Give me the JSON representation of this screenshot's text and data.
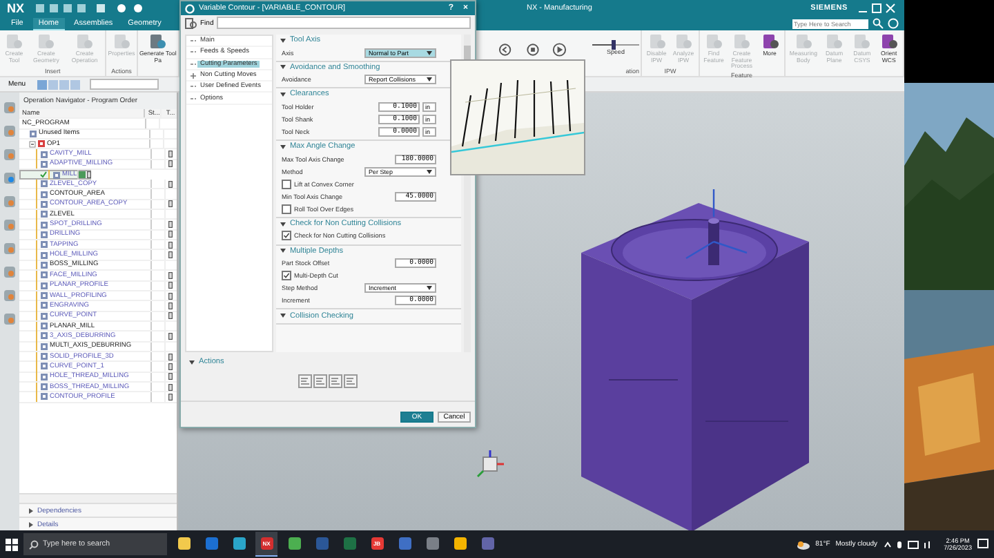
{
  "app": {
    "logo": "NX",
    "title": "NX - Manufacturing",
    "brand": "SIEMENS"
  },
  "tabs": [
    {
      "label": "File",
      "selected": false
    },
    {
      "label": "Home",
      "selected": true
    },
    {
      "label": "Assemblies",
      "selected": false
    },
    {
      "label": "Geometry",
      "selected": false
    }
  ],
  "search": {
    "placeholder": "Type Here to Search"
  },
  "ribbon_left": [
    {
      "group": "Insert",
      "buttons": [
        {
          "label": "Create Tool",
          "disabled": true
        },
        {
          "label": "Create Geometry",
          "disabled": true
        },
        {
          "label": "Create Operation",
          "disabled": true
        }
      ]
    },
    {
      "group": "Actions",
      "buttons": [
        {
          "label": "Properties",
          "disabled": true
        }
      ]
    },
    {
      "buttons": [
        {
          "label": "Generate Tool Pa",
          "disabled": false
        }
      ]
    }
  ],
  "ribbon_right": [
    {
      "kind": "simulation",
      "group": "ation",
      "speed": {
        "label": "Speed",
        "level": 0.45
      }
    },
    {
      "kind": "buttons",
      "group": "IPW",
      "buttons": [
        {
          "label": "Disable IPW",
          "disabled": true
        },
        {
          "label": "Analyze IPW",
          "disabled": true
        }
      ]
    },
    {
      "kind": "buttons",
      "group": "Feature",
      "buttons": [
        {
          "label": "Find Feature",
          "disabled": true
        },
        {
          "label": "Create Feature Process",
          "disabled": true
        },
        {
          "label": "More",
          "disabled": false
        }
      ]
    },
    {
      "kind": "buttons",
      "buttons": [
        {
          "label": "Measuring Body",
          "disabled": true
        },
        {
          "label": "Datum Plane",
          "disabled": true
        },
        {
          "label": "Datum CSYS",
          "disabled": true
        },
        {
          "label": "Orient WCS",
          "disabled": false
        }
      ]
    }
  ],
  "toolbar": {
    "menu": "Menu"
  },
  "navigator": {
    "title": "Operation Navigator - Program Order",
    "columns": [
      "Name",
      "St...",
      "T..."
    ],
    "tree": {
      "label": "NC_PROGRAM",
      "children": [
        {
          "label": "Unused Items"
        },
        {
          "label": "OP1",
          "children": [
            {
              "label": "CAVITY_MILL",
              "generated": true,
              "complete": false
            },
            {
              "label": "ADAPTIVE_MILLING",
              "generated": true,
              "complete": false
            },
            {
              "label": "MILL",
              "generated": true,
              "complete": true
            },
            {
              "label": "ZLEVEL_COPY",
              "generated": true,
              "complete": false
            },
            {
              "label": "CONTOUR_AREA",
              "generated": false,
              "complete": false
            },
            {
              "label": "CONTOUR_AREA_COPY",
              "generated": true,
              "complete": false
            },
            {
              "label": "ZLEVEL",
              "generated": false,
              "complete": false
            },
            {
              "label": "SPOT_DRILLING",
              "generated": true,
              "complete": false
            },
            {
              "label": "DRILLING",
              "generated": true,
              "complete": false
            },
            {
              "label": "TAPPING",
              "generated": true,
              "complete": false
            },
            {
              "label": "HOLE_MILLING",
              "generated": true,
              "complete": false
            },
            {
              "label": "BOSS_MILLING",
              "generated": false,
              "complete": false
            },
            {
              "label": "FACE_MILLING",
              "generated": true,
              "complete": false
            },
            {
              "label": "PLANAR_PROFILE",
              "generated": true,
              "complete": false
            },
            {
              "label": "WALL_PROFILING",
              "generated": true,
              "complete": false
            },
            {
              "label": "ENGRAVING",
              "generated": true,
              "complete": false
            },
            {
              "label": "CURVE_POINT",
              "generated": true,
              "complete": false
            },
            {
              "label": "PLANAR_MILL",
              "generated": false,
              "complete": false
            },
            {
              "label": "3_AXIS_DEBURRING",
              "generated": true,
              "complete": false
            },
            {
              "label": "MULTI_AXIS_DEBURRING",
              "generated": false,
              "complete": false
            },
            {
              "label": "SOLID_PROFILE_3D",
              "generated": true,
              "complete": false
            },
            {
              "label": "CURVE_POINT_1",
              "generated": true,
              "complete": false
            },
            {
              "label": "HOLE_THREAD_MILLING",
              "generated": true,
              "complete": false
            },
            {
              "label": "BOSS_THREAD_MILLING",
              "generated": true,
              "complete": false
            },
            {
              "label": "CONTOUR_PROFILE",
              "generated": true,
              "complete": false
            }
          ]
        }
      ]
    },
    "panels": [
      {
        "label": "Dependencies",
        "expanded": false
      },
      {
        "label": "Details",
        "expanded": false
      }
    ]
  },
  "dialog": {
    "title": "Variable Contour - [VARIABLE_CONTOUR]",
    "help": "?",
    "close": "×",
    "find_label": "Find",
    "tree": [
      {
        "label": "Main",
        "selected": false,
        "expandable": false
      },
      {
        "label": "Feeds & Speeds",
        "selected": false,
        "expandable": false
      },
      {
        "label": "Cutting Parameters",
        "selected": true,
        "expandable": false
      },
      {
        "label": "Non Cutting Moves",
        "selected": false,
        "expandable": true
      },
      {
        "label": "User Defined Events",
        "selected": false,
        "expandable": false
      },
      {
        "label": "Options",
        "selected": false,
        "expandable": false
      }
    ],
    "sections": [
      {
        "title": "Tool Axis",
        "rows": [
          {
            "kind": "select",
            "label": "Axis",
            "value": "Normal to Part",
            "highlighted": true
          }
        ]
      },
      {
        "title": "Avoidance and Smoothing",
        "rows": [
          {
            "kind": "select",
            "label": "Avoidance",
            "value": "Report Collisions",
            "highlighted": false
          }
        ]
      },
      {
        "title": "Clearances",
        "rows": [
          {
            "kind": "number",
            "label": "Tool Holder",
            "value": "0.1000",
            "unit": "in"
          },
          {
            "kind": "number",
            "label": "Tool Shank",
            "value": "0.1000",
            "unit": "in"
          },
          {
            "kind": "number",
            "label": "Tool Neck",
            "value": "0.0000",
            "unit": "in"
          }
        ]
      },
      {
        "title": "Max Angle Change",
        "rows": [
          {
            "kind": "number",
            "label": "Max Tool Axis Change",
            "value": "180.0000"
          },
          {
            "kind": "select",
            "label": "Method",
            "value": "Per Step",
            "highlighted": false
          },
          {
            "kind": "check",
            "label": "Lift at Convex Corner",
            "checked": false
          },
          {
            "kind": "number",
            "label": "Min Tool Axis Change",
            "value": "45.0000"
          },
          {
            "kind": "check",
            "label": "Roll Tool Over Edges",
            "checked": false
          }
        ]
      },
      {
        "title": "Check for Non Cutting Collisions",
        "rows": [
          {
            "kind": "check",
            "label": "Check for Non Cutting Collisions",
            "checked": true
          }
        ]
      },
      {
        "title": "Multiple Depths",
        "rows": [
          {
            "kind": "number",
            "label": "Part Stock Offset",
            "value": "0.0000"
          },
          {
            "kind": "check",
            "label": "Multi-Depth Cut",
            "checked": true
          },
          {
            "kind": "select",
            "label": "Step Method",
            "value": "Increment",
            "highlighted": false
          },
          {
            "kind": "number",
            "label": "Increment",
            "value": "0.0000"
          }
        ]
      },
      {
        "title": "Collision Checking"
      }
    ],
    "actions_title": "Actions",
    "buttons": [
      {
        "label": "OK",
        "primary": true
      },
      {
        "label": "Cancel",
        "primary": false
      }
    ]
  },
  "taskbar": {
    "search_placeholder": "Type here to search",
    "apps": [
      {
        "color": "#f2c94c",
        "active": false
      },
      {
        "color": "#1c6fd1",
        "active": false
      },
      {
        "color": "#2aa5c9",
        "active": false
      },
      {
        "color": "#d32f2f",
        "text": "NX",
        "active": true
      },
      {
        "color": "#4caf50",
        "active": false
      },
      {
        "color": "#2b5797",
        "active": false
      },
      {
        "color": "#1e7145",
        "active": false
      },
      {
        "color": "#e53935",
        "text": "JB",
        "active": false
      },
      {
        "color": "#3f6fc4",
        "active": false
      },
      {
        "color": "#7a7f87",
        "active": false
      },
      {
        "color": "#f4b400",
        "active": false
      },
      {
        "color": "#6264a7",
        "active": false
      }
    ],
    "weather": {
      "temp": "81°F",
      "text": "Mostly cloudy"
    },
    "time": "2:46 PM",
    "date": "7/26/2023"
  }
}
